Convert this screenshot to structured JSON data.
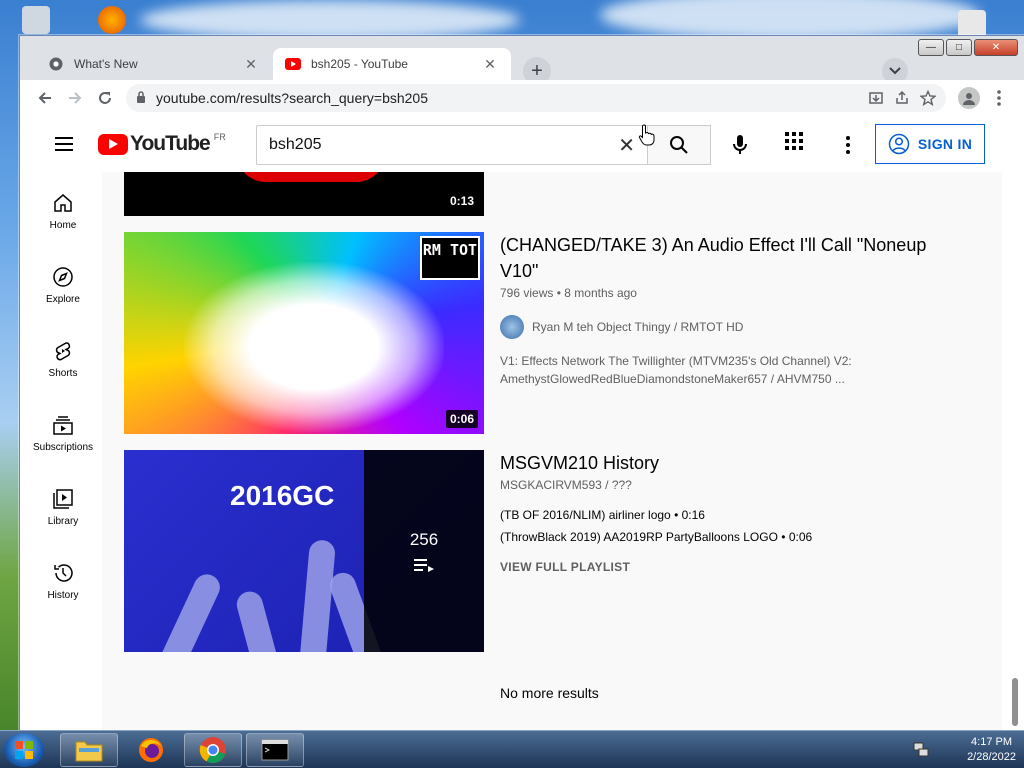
{
  "browser": {
    "tabs": [
      {
        "title": "What's New",
        "active": false
      },
      {
        "title": "bsh205 - YouTube",
        "active": true
      }
    ],
    "url": "youtube.com/results?search_query=bsh205"
  },
  "youtube": {
    "country_code": "FR",
    "logo_text": "YouTube",
    "search_value": "bsh205",
    "sign_in_label": "SIGN IN",
    "guide": [
      {
        "label": "Home",
        "icon": "home-icon"
      },
      {
        "label": "Explore",
        "icon": "compass-icon"
      },
      {
        "label": "Shorts",
        "icon": "shorts-icon"
      },
      {
        "label": "Subscriptions",
        "icon": "subscriptions-icon"
      },
      {
        "label": "Library",
        "icon": "library-icon"
      },
      {
        "label": "History",
        "icon": "history-icon"
      }
    ],
    "results": [
      {
        "type": "video",
        "duration": "0:13"
      },
      {
        "type": "video",
        "title": "(CHANGED/TAKE 3) An Audio Effect I'll Call \"Noneup V10\"",
        "views": "796 views",
        "age": "8 months ago",
        "channel": "Ryan M teh Object Thingy / RMTOT HD",
        "description": "V1: Effects Network The Twillighter (MTVM235's Old Channel) V2: AmethystGlowedRedBlueDiamondstoneMaker657 / AHVM750 ...",
        "duration": "0:06",
        "thumb_text": "RM TOT"
      },
      {
        "type": "playlist",
        "title": "MSGVM210 History",
        "channel": "MSGKACIRVM593 / ???",
        "thumb_text": "2016GC",
        "count": "256",
        "items": [
          {
            "title": "(TB OF 2016/NLIM) airliner logo",
            "duration": "0:16"
          },
          {
            "title": "(ThrowBlack 2019) AA2019RP PartyBalloons LOGO",
            "duration": "0:06"
          }
        ],
        "view_full_label": "VIEW FULL PLAYLIST"
      }
    ],
    "end_text": "No more results"
  },
  "taskbar": {
    "time": "4:17 PM",
    "date": "2/28/2022"
  },
  "colors": {
    "yt_red": "#ff0000",
    "signin_blue": "#065fd4",
    "tab_bar": "#dee1e6"
  }
}
